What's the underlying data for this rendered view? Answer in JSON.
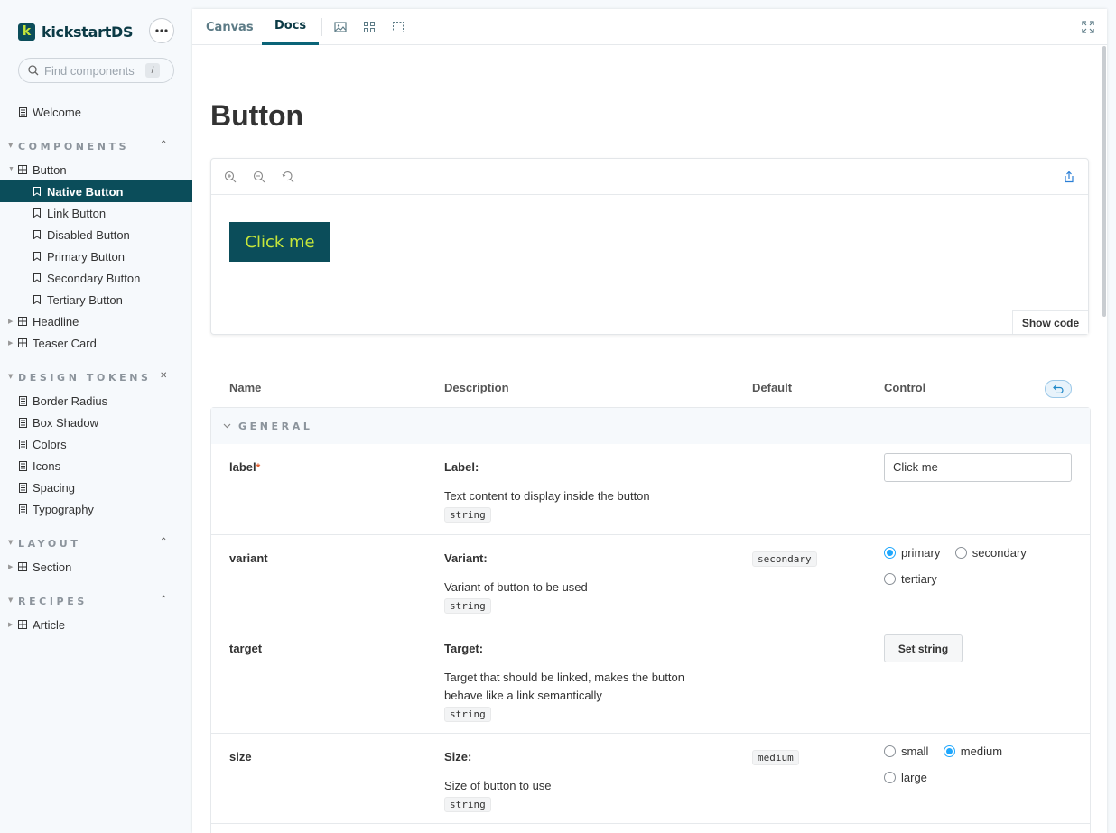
{
  "brand": {
    "name": "kickstartDS",
    "logo_letter": "k"
  },
  "search": {
    "placeholder": "Find components",
    "shortcut": "/"
  },
  "sidebar": {
    "welcome": "Welcome",
    "sections": [
      {
        "title": "COMPONENTS"
      },
      {
        "title": "DESIGN TOKENS"
      },
      {
        "title": "LAYOUT"
      },
      {
        "title": "RECIPES"
      }
    ],
    "components": {
      "button": "Button",
      "stories": [
        "Native Button",
        "Link Button",
        "Disabled Button",
        "Primary Button",
        "Secondary Button",
        "Tertiary Button"
      ],
      "headline": "Headline",
      "teaser_card": "Teaser Card"
    },
    "tokens": [
      "Border Radius",
      "Box Shadow",
      "Colors",
      "Icons",
      "Spacing",
      "Typography"
    ],
    "layout": [
      "Section"
    ],
    "recipes": [
      "Article"
    ]
  },
  "toolbar": {
    "tabs": [
      "Canvas",
      "Docs"
    ]
  },
  "page": {
    "title": "Button"
  },
  "preview": {
    "button_label": "Click me",
    "show_code": "Show code"
  },
  "args_table": {
    "headers": {
      "name": "Name",
      "description": "Description",
      "default": "Default",
      "control": "Control"
    },
    "group": "GENERAL",
    "rows": {
      "label": {
        "name": "label",
        "required": "*",
        "title": "Label:",
        "desc": "Text content to display inside the button",
        "type": "string",
        "value": "Click me"
      },
      "variant": {
        "name": "variant",
        "title": "Variant:",
        "desc": "Variant of button to be used",
        "type": "string",
        "default": "secondary",
        "options": [
          "primary",
          "secondary",
          "tertiary"
        ],
        "selected": "primary"
      },
      "target": {
        "name": "target",
        "title": "Target:",
        "desc": "Target that should be linked, makes the button behave like a link semantically",
        "type": "string",
        "button": "Set string"
      },
      "size": {
        "name": "size",
        "title": "Size:",
        "desc": "Size of button to use",
        "type": "string",
        "default": "medium",
        "options": [
          "small",
          "medium",
          "large"
        ],
        "selected": "medium"
      }
    }
  },
  "colors": {
    "brand_dark": "#0b4d5a",
    "brand_accent": "#c5e53a",
    "control_blue": "#1ea7fd"
  }
}
